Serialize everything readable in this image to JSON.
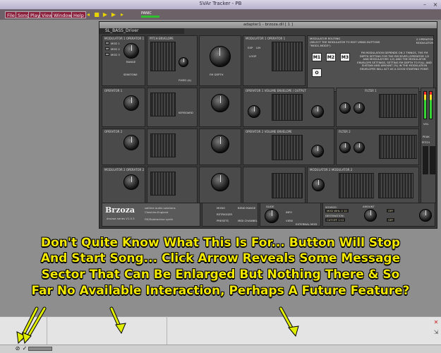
{
  "window": {
    "title": "SVAr Tracker - PB"
  },
  "menu": {
    "items": [
      "File",
      "Song",
      "Play",
      "View",
      "Windows",
      "Help"
    ]
  },
  "toolbar": {
    "meter_label": "PANIC"
  },
  "plugin": {
    "window_title": "adapter1 - brzoza.dll [ 1 ]",
    "preset_name": "SL_BASS_Driver",
    "panels": {
      "mod1_operator1": "MODULATOR 1 OPERATOR 1",
      "pitch_envelope": "PITCH ENVELOPE",
      "mod1_operator1b": "MODULATOR 1 OPERATOR 1",
      "operator1": "OPERATOR 1",
      "operator1_vol": "OPERATOR 1 VOLUME ENVELOPE / OUTPUT",
      "operator2": "OPERATOR 2",
      "operator2_vol": "OPERATOR 2 VOLUME ENVELOPE",
      "mod2_operator2": "MODULATOR 2 OPERATOR 2",
      "mod2_modulator2": "MODULATOR 2 MODULATOR 2",
      "filter1": "FILTER 1",
      "filter2": "FILTER 2",
      "output_volume": "OUTPUT VOLUME"
    },
    "routing": {
      "title": "MODULATOR ROUTING",
      "subtitle": "(SELECT THE MODULATOR TO EDIT USING BUTTONS \"MOD1-MOD3\")",
      "operator_mod": "2-OPERATOR MODULATOR",
      "description": "FM MODULATION DEPENDS ON 2 THINGS, THE FM DEPTH SETTING FOR THE RECEIVER (OPERATOR 1/2 AND MODULATORS 1/2) AND THE MODULATOR ENVELOPE SETTINGS. SETTING FM DEPTH TO FULL AND SUSTAIN AND AMOUNT (%) IN THE MODULATION ENVELOPES WILL ACT AS A GOOD STARTING POINT.",
      "boxes": [
        "M1",
        "M2",
        "M3",
        "O"
      ]
    },
    "labels": {
      "mod1": "MOD 1",
      "mod2": "MOD 2",
      "mod3": "MOD 3",
      "range": "RANGE",
      "semitone": "SEMITONE",
      "keyboard": "KEYBOARD",
      "fixed": "FIXED (A)",
      "fm_depth": "FM DEPTH",
      "exp": "EXP",
      "lin": "LIN",
      "loop": "LOOP",
      "pan": "PAN",
      "cutoff": "CUTOFF",
      "reson": "RESON",
      "mono": "MONO",
      "retrigger": "RETRIGGER",
      "presets": "PRESETS",
      "bend_range": "BEND RANGE",
      "midi_channel": "MIDI CHANNEL",
      "glide": "GLIDE",
      "info": "INFO",
      "view": "VIEW",
      "external_mod": "EXTERNAL MOD",
      "source": "SOURCE:",
      "destination": "DESTINATION:",
      "amount": "AMOUNT",
      "source_value": "MOD WHL 0 10",
      "destination_value": "CUTOFF 1+2",
      "source2_value": "OFF",
      "destination2_value": "OFF",
      "vol": "VOL",
      "peak": "PEAK",
      "pitch": "PITCH",
      "mod": "MOD"
    },
    "logo": {
      "name": "Brzoza",
      "company": "saltline audio solutions",
      "location": "Cheshire-England",
      "series": "drozwa series V1.0.3",
      "type": "FM/Subtractive synth"
    }
  },
  "annotation": {
    "lines": [
      "Don't Quite Know What This Is For... Button Will Stop",
      "And Start Song... Click Arrow Reveals Some Message",
      "Sector That Can Be Enlarged But Nothing There & So",
      "Far No Available Interaction, Perhaps A Future Feature?"
    ],
    "colors": {
      "text": "#f3e800",
      "arrows": "#e0ec00"
    }
  },
  "statusbar": {
    "icons": [
      "record-stop-icon",
      "checkmark-icon"
    ]
  },
  "colors": {
    "menu_accent": "#8a1f3c",
    "play_icons": "#e7d300"
  }
}
